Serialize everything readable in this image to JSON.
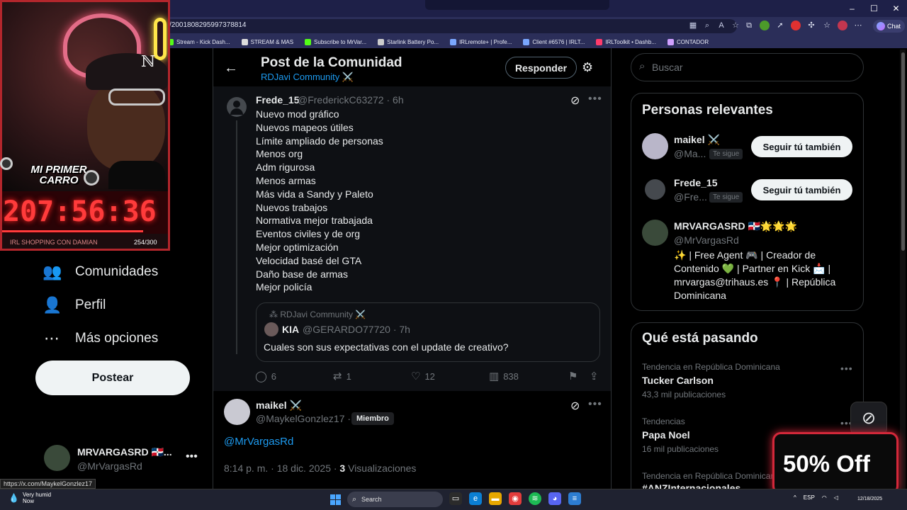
{
  "browser": {
    "url": "/2001808295997378814",
    "chat_label": "Chat",
    "window_controls": [
      "–",
      "☐",
      "✕"
    ],
    "bookmarks": [
      {
        "label": "Stream - Kick Dash...",
        "icon": "kick-icon",
        "color": "#53fc18"
      },
      {
        "label": "STREAM & MAS",
        "icon": "folder-icon",
        "color": "#dddddd"
      },
      {
        "label": "Subscribe to MrVar...",
        "icon": "kick-icon",
        "color": "#53fc18"
      },
      {
        "label": "Starlink Battery Po...",
        "icon": "page-icon",
        "color": "#cccccc"
      },
      {
        "label": "IRLremote+ | Profe...",
        "icon": "globe-icon",
        "color": "#7aa7ff"
      },
      {
        "label": "Client #6576 | IRLT...",
        "icon": "globe-icon",
        "color": "#7aa7ff"
      },
      {
        "label": "IRLToolkit • Dashb...",
        "icon": "irl-icon",
        "color": "#ff3b6b"
      },
      {
        "label": "CONTADOR",
        "icon": "app-icon",
        "color": "#d0a0ff"
      }
    ]
  },
  "overlay": {
    "car_label": "MI PRIMER CARRO",
    "timer": "207:56:36",
    "goal_label": "IRL SHOPPING CON DAMIAN",
    "goal_count": "254/300",
    "goal_progress": 0.85
  },
  "nav": {
    "items": [
      {
        "label": "Comunidades",
        "icon": "communities-icon",
        "glyph": "👥"
      },
      {
        "label": "Perfil",
        "icon": "profile-icon",
        "glyph": "👤"
      },
      {
        "label": "Más opciones",
        "icon": "more-options-icon",
        "glyph": "⋯"
      }
    ],
    "post_button": "Postear"
  },
  "account": {
    "name": "MRVARGASRD 🇩🇴...",
    "handle": "@MrVargasRd",
    "more": "•••"
  },
  "status_url": "https://x.com/MaykelGonzlez17",
  "header": {
    "title": "Post de la Comunidad",
    "community": "RDJavi Community ⚔️",
    "reply_label": "Responder"
  },
  "post1": {
    "name": "Frede_15",
    "handle_time": "@FrederickC63272 · 6h",
    "lines": [
      "Nuevo mod gráfico",
      "Nuevos mapeos útiles",
      "Límite ampliado de personas",
      "Menos org",
      "Adm rigurosa",
      "Menos armas",
      "Más vida a Sandy y Paleto",
      "Nuevos trabajos",
      "Normativa mejor trabajada",
      "Eventos civiles y de org",
      "Mejor optimización",
      "Velocidad basé del GTA",
      "Daño base de armas",
      "Mejor policía"
    ],
    "quote": {
      "community": "RDJavi Community ⚔️",
      "name": "KIA",
      "handle_time": "@GERARDO77720 · 7h",
      "text": "Cuales son sus expectativas con el update de creativo?"
    },
    "actions": {
      "replies": "6",
      "reposts": "1",
      "likes": "12",
      "views": "838"
    }
  },
  "post2": {
    "name": "maikel ⚔️",
    "handle": "@MaykelGonzlez17 ·",
    "badge": "Miembro",
    "mention": "@MrVargasRd",
    "time": "8:14 p. m. · 18 dic. 2025 · ",
    "views_count": "3",
    "views_label": " Visualizaciones"
  },
  "search": {
    "placeholder": "Buscar"
  },
  "relevant": {
    "title": "Personas relevantes",
    "people": [
      {
        "name": "maikel ⚔️",
        "handle": "@Ma...",
        "badge": "Te sigue",
        "button": "Seguir tú también"
      },
      {
        "name": "Frede_15",
        "handle": "@Fre...",
        "badge": "Te sigue",
        "button": "Seguir tú también"
      },
      {
        "name": "MRVARGASRD 🇩🇴🌟🌟🌟",
        "handle": "@MrVargasRd",
        "bio": "✨ | Free Agent 🎮 | Creador de Contenido 💚 | Partner en Kick 📩 | mrvargas@trihaus.es 📍 | República Dominicana"
      }
    ]
  },
  "trends": {
    "title": "Qué está pasando",
    "items": [
      {
        "context": "Tendencia en República Dominicana",
        "name": "Tucker Carlson",
        "count": "43,3 mil publicaciones"
      },
      {
        "context": "Tendencias",
        "name": "Papa Noel",
        "count": "16 mil publicaciones"
      },
      {
        "context": "Tendencia en República Dominicana",
        "name": "#ANZInternacionales",
        "count": ""
      }
    ]
  },
  "promo": {
    "text": "50% Off"
  },
  "taskbar": {
    "weather_line1": "Very humid",
    "weather_line2": "Now",
    "search_label": "Search",
    "language": "ESP",
    "time": "",
    "date": "12/18/2025"
  },
  "colors": {
    "accent": "#1d9bf0",
    "muted": "#71767b",
    "overlay_red": "#b3262c"
  }
}
